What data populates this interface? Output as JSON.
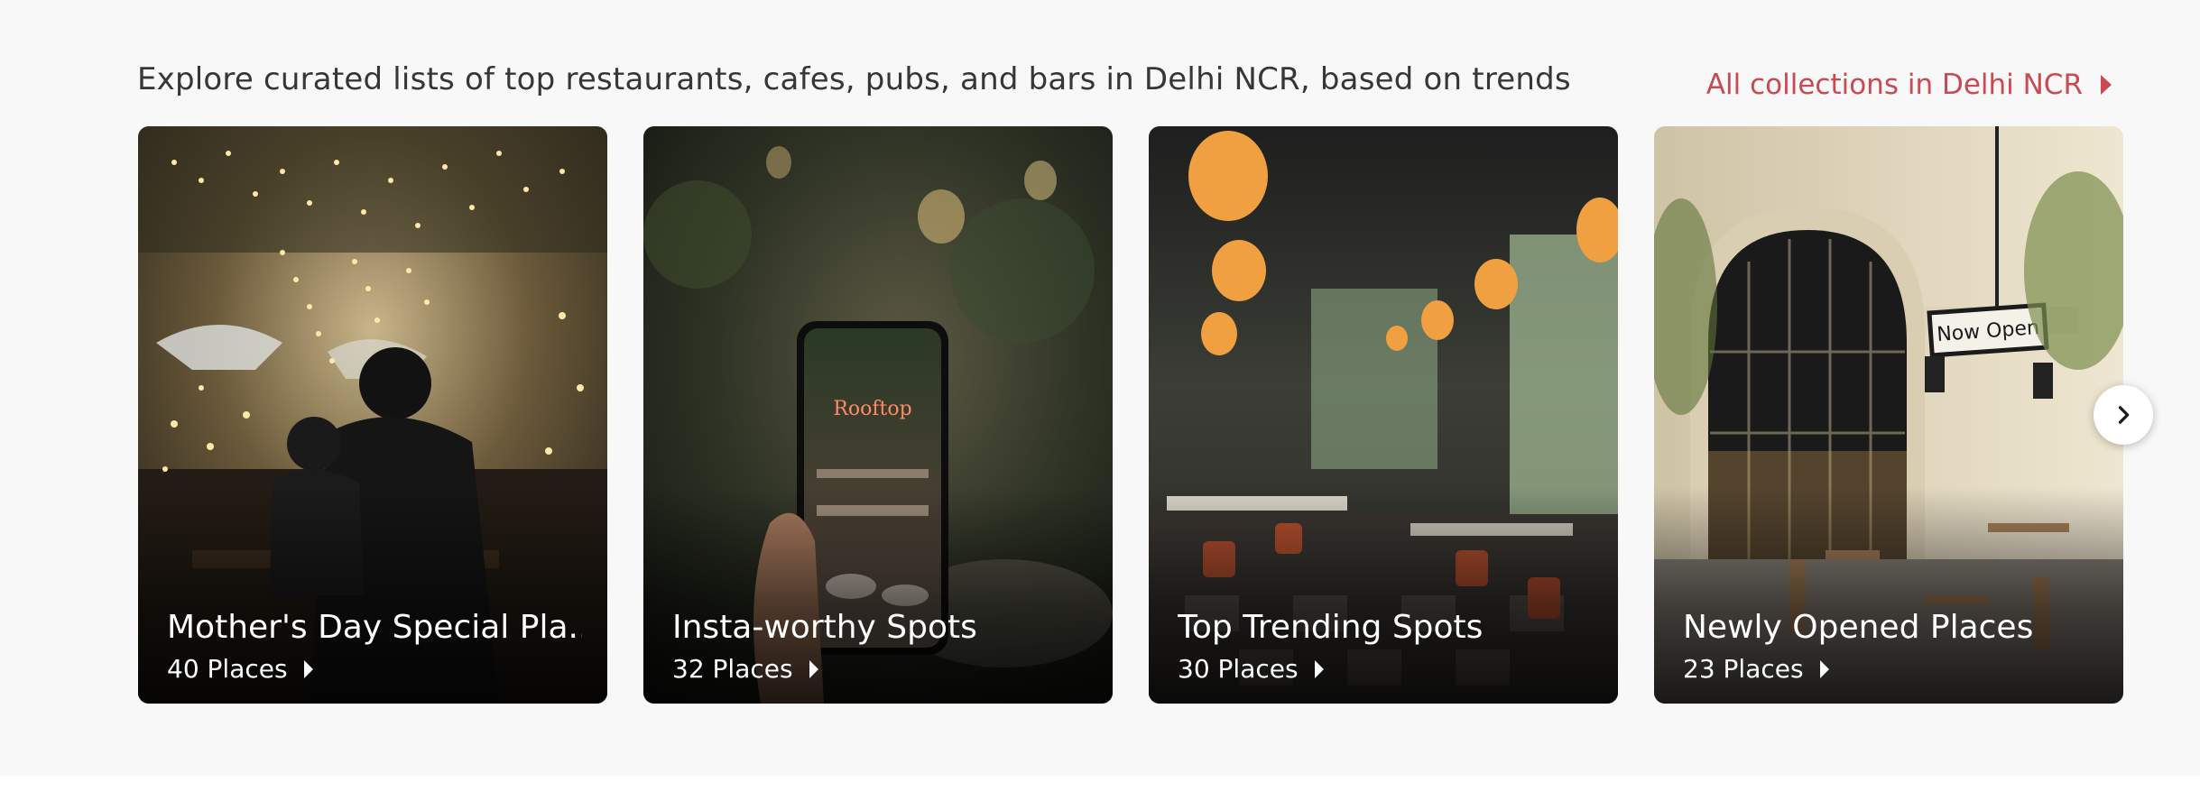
{
  "collections": {
    "subtitle": "Explore curated lists of top restaurants, cafes, pubs, and bars in Delhi NCR, based on trends",
    "all_link_label": "All collections in Delhi NCR",
    "cards": [
      {
        "title": "Mother's Day Special Pla...",
        "count": "40 Places"
      },
      {
        "title": "Insta-worthy Spots",
        "count": "32 Places"
      },
      {
        "title": "Top Trending Spots",
        "count": "30 Places"
      },
      {
        "title": "Newly Opened Places",
        "count": "23 Places"
      }
    ],
    "sign_text": "Now Open",
    "neon_text": "Rooftop"
  },
  "icons": {
    "next": "chevron-right-icon",
    "link_arrow": "caret-right-icon",
    "card_arrow": "caret-right-icon"
  },
  "colors": {
    "accent": "#c94a52",
    "section_bg": "#f8f8f8",
    "text": "#363636"
  }
}
